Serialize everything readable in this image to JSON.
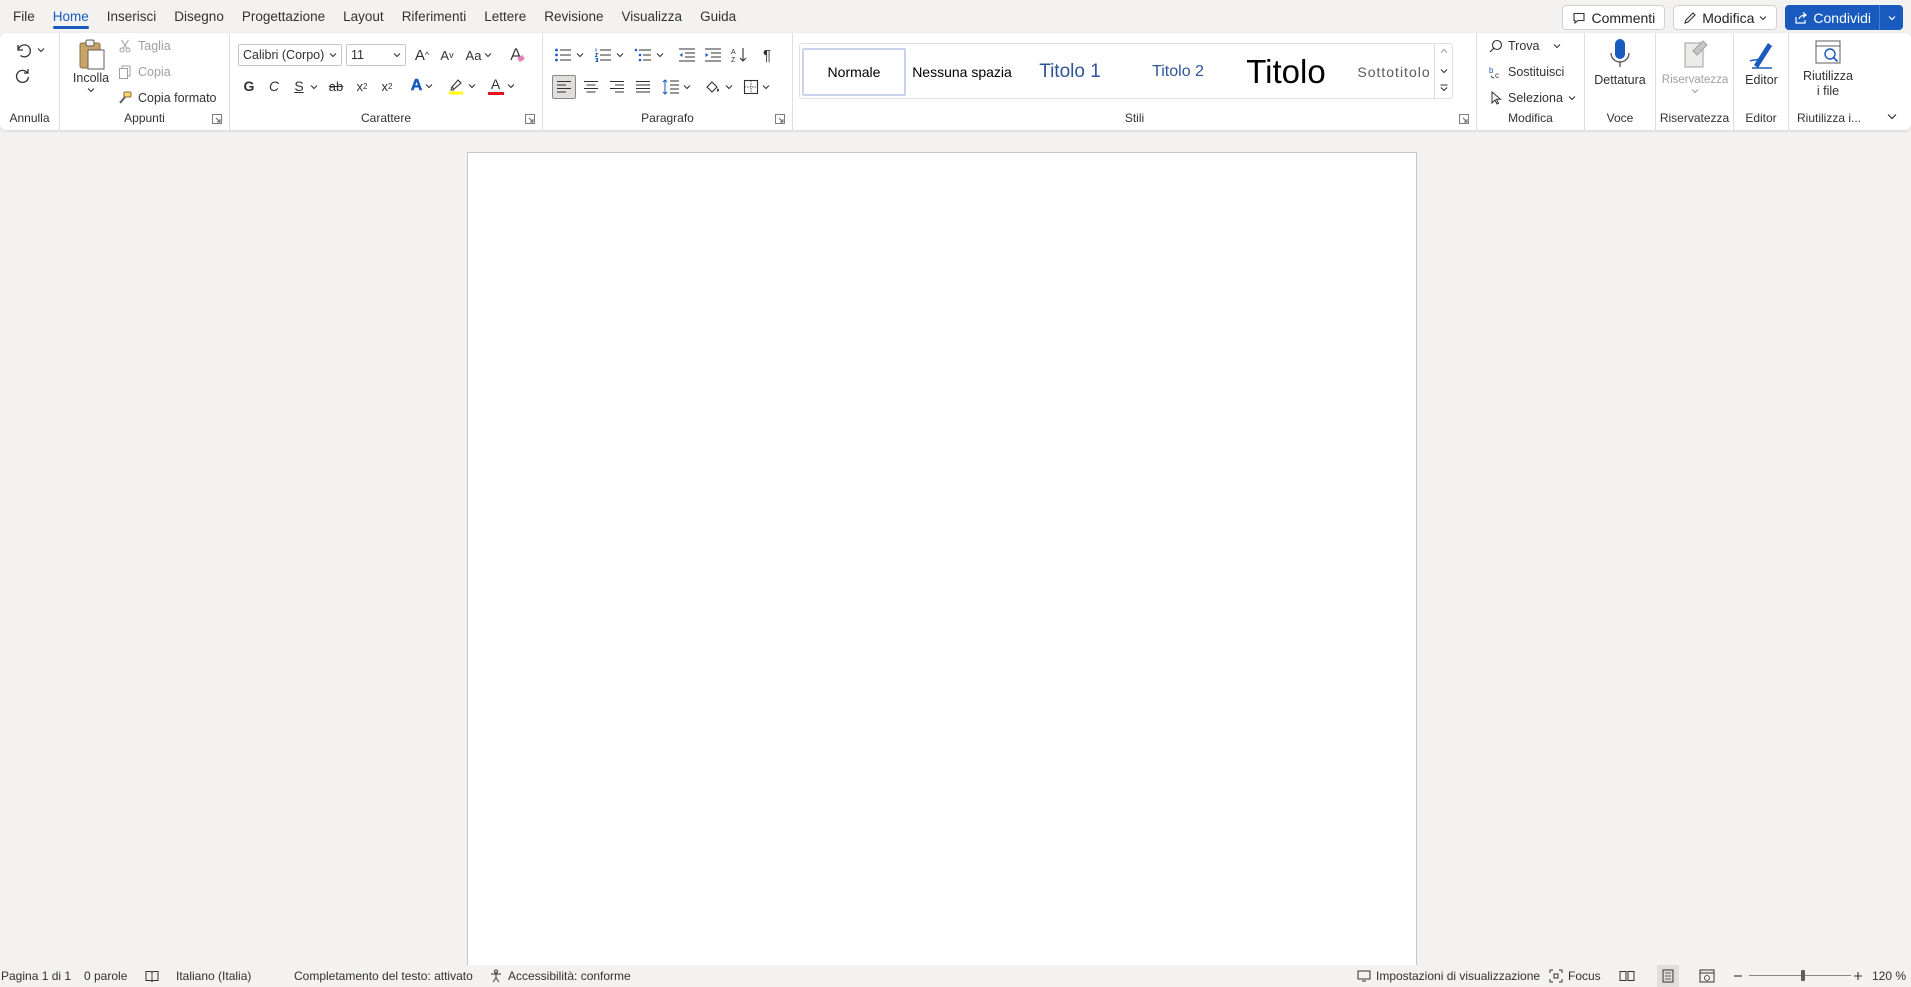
{
  "menubar": {
    "tabs": [
      "File",
      "Home",
      "Inserisci",
      "Disegno",
      "Progettazione",
      "Layout",
      "Riferimenti",
      "Lettere",
      "Revisione",
      "Visualizza",
      "Guida"
    ],
    "active_tab": "Home",
    "comments_label": "Commenti",
    "edit_label": "Modifica",
    "share_label": "Condividi"
  },
  "ribbon": {
    "undo": {
      "label": "Annulla"
    },
    "clipboard": {
      "label": "Appunti",
      "paste": "Incolla",
      "cut": "Taglia",
      "copy": "Copia",
      "format_painter": "Copia formato"
    },
    "font": {
      "label": "Carattere",
      "font_name": "Calibri (Corpo)",
      "font_size": "11",
      "bold": "G",
      "italic": "C",
      "underline": "S",
      "strikethrough": "ab",
      "subscript": "x",
      "superscript": "x",
      "change_case": "Aa",
      "grow": "A",
      "shrink": "A",
      "text_effects": "A",
      "font_color": "A",
      "highlight_color": "#ffff00",
      "font_color_value": "#e81123"
    },
    "paragraph": {
      "label": "Paragrafo"
    },
    "styles": {
      "label": "Stili",
      "items": [
        "Normale",
        "Nessuna spazia",
        "Titolo 1",
        "Titolo 2",
        "Titolo",
        "Sottotitolo"
      ],
      "selected": "Normale"
    },
    "editing": {
      "label": "Modifica",
      "find": "Trova",
      "replace": "Sostituisci",
      "select": "Seleziona"
    },
    "voice": {
      "label": "Voce",
      "dictate": "Dettatura"
    },
    "sensitivity": {
      "label": "Riservatezza",
      "button": "Riservatezza"
    },
    "editor": {
      "label": "Editor",
      "button": "Editor"
    },
    "reuse": {
      "label": "Riutilizza i...",
      "button_line1": "Riutilizza",
      "button_line2": "i file"
    }
  },
  "statusbar": {
    "page": "Pagina 1 di 1",
    "words": "0 parole",
    "language": "Italiano (Italia)",
    "text_predictions": "Completamento del testo: attivato",
    "accessibility": "Accessibilità: conforme",
    "display_settings": "Impostazioni di visualizzazione",
    "focus": "Focus",
    "zoom": "120 %",
    "zoom_level_percent": 120
  },
  "colors": {
    "accent": "#185abd",
    "ribbon_bg": "#ffffff",
    "app_bg": "#f3f2f1"
  }
}
